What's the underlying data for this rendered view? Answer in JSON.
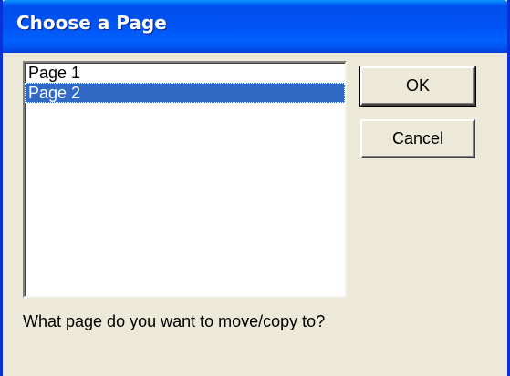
{
  "window": {
    "title": "Choose a Page"
  },
  "pages_list": {
    "items": [
      "Page 1",
      "Page 2"
    ],
    "selected": "Page 2"
  },
  "buttons": {
    "ok_label": "OK",
    "cancel_label": "Cancel"
  },
  "prompt_text": "What page do you want to move/copy to?",
  "colors": {
    "titlebar": "#0053ee",
    "selection": "#316ac5",
    "dialog_bg": "#ece9d8"
  }
}
